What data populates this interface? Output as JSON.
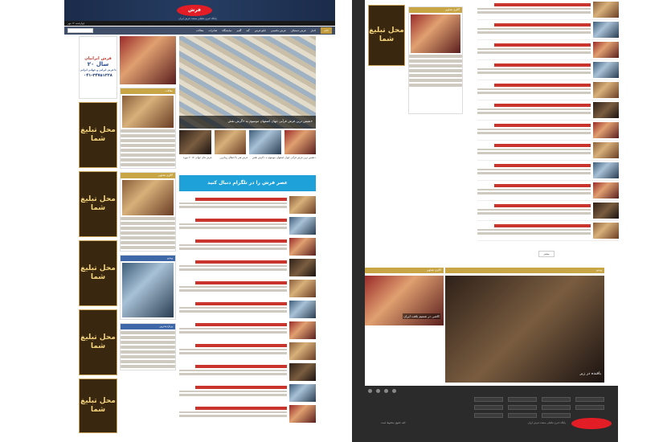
{
  "header": {
    "logo_text": "فرش",
    "tagline": "پایگاه خبری تحلیلی صنعت فرش ایران",
    "topbar_text": "چهارشنبه ۱۲ مهر"
  },
  "nav": {
    "items": [
      "خانه",
      "اخبار",
      "فرش دستباف",
      "فرش ماشینی",
      "تابلو فرش",
      "گبه",
      "گلیم",
      "نمایشگاه",
      "صادرات",
      "مقالات"
    ]
  },
  "ads": {
    "top_brand": "فرش ایرانیان",
    "top_years": "۲۰ سال",
    "top_desc": "با فرش ایرانی و جهانی ایرانی",
    "top_phone": "۰۴۱-۳۴۷۵۱۲۲۸",
    "slot_text": "محل تبلیغ شما"
  },
  "feature": {
    "caption": "نفیس ترین فرش قرآنی جهان اصفهان موسوم به «گرش نقش»",
    "thumb_captions": [
      "فرش های جهانی ۲۰۱۷ موزه",
      "فرش هنر با اعطای زیباترین",
      "نفیس ترین فرش قرآنی جهان اصفهان موسوم به «گرش نقش»"
    ]
  },
  "telegram": {
    "label": "عصر فرش را در تلگرام دنبال کنید"
  },
  "sections": {
    "latest": "آخرین اخبار",
    "most_viewed": "پربازدیدترین",
    "articles": "مقالات",
    "gallery": "گالری تصاویر",
    "video": "ویدیو"
  },
  "right": {
    "big_caption": "بافنده در زیر",
    "small_caption": "کاشی در شمیم بافت ایران",
    "more_label": "بیشتر"
  },
  "footer": {
    "links": [
      "درباره ما",
      "تماس با ما",
      "آرشیو",
      "تبلیغات",
      "آموزش"
    ],
    "about": "پایگاه خبری تحلیلی صنعت فرش ایران",
    "copyright": "کلیه حقوق محفوظ است"
  }
}
